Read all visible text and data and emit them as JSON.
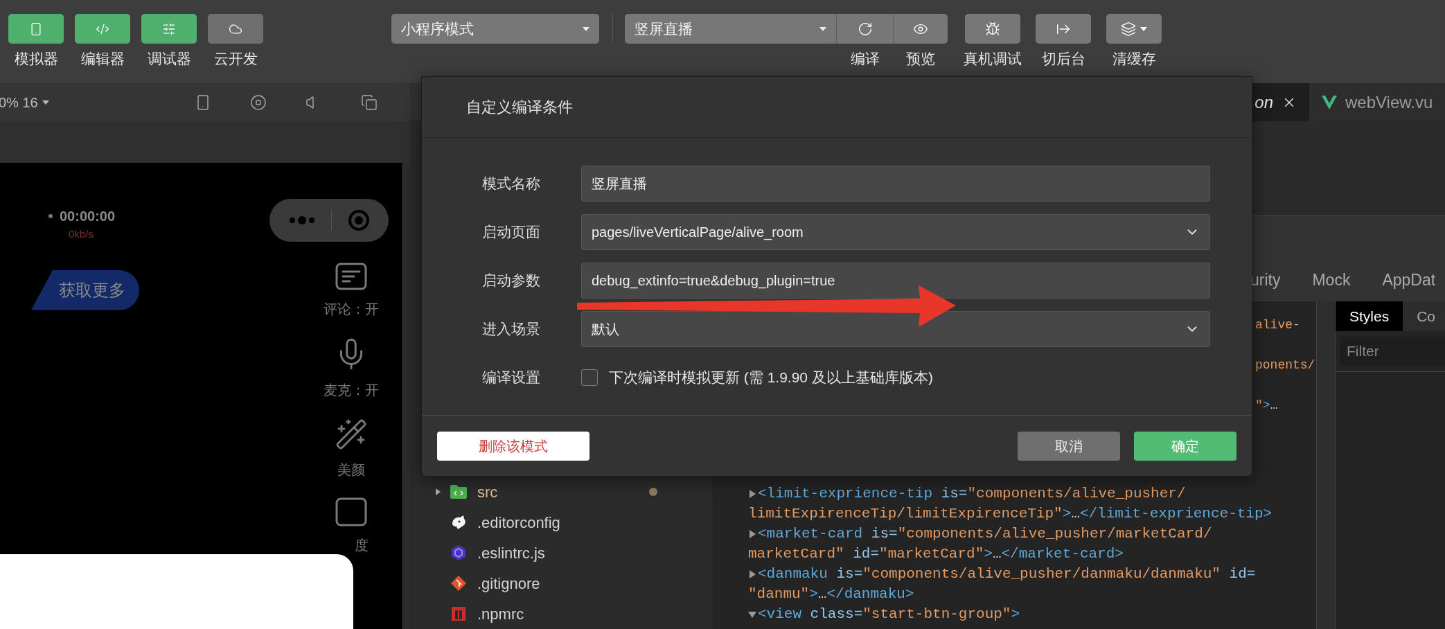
{
  "toolbar": {
    "views": [
      {
        "label": "模拟器",
        "on": true
      },
      {
        "label": "编辑器",
        "on": true
      },
      {
        "label": "调试器",
        "on": true
      },
      {
        "label": "云开发",
        "on": false
      }
    ],
    "mode_select": "小程序模式",
    "compile_select": "竖屏直播",
    "compile_actions": [
      {
        "label": "编译"
      },
      {
        "label": "预览"
      }
    ],
    "actions": [
      {
        "label": "真机调试"
      },
      {
        "label": "切后台"
      },
      {
        "label": "清缓存"
      }
    ]
  },
  "simulator": {
    "zoom": "0% 16",
    "timer": "00:00:00",
    "bitrate": "0kb/s",
    "more_badge": "获取更多",
    "side_controls": [
      {
        "label": "评论：开"
      },
      {
        "label": "麦克：开"
      },
      {
        "label": "美颜"
      },
      {
        "label": "度"
      }
    ]
  },
  "file_tree": [
    {
      "kind": "folder",
      "name": "src",
      "expanded": false,
      "modified": true
    },
    {
      "kind": "file",
      "name": ".editorconfig",
      "modified": false
    },
    {
      "kind": "file",
      "name": ".eslintrc.js",
      "modified": false
    },
    {
      "kind": "file",
      "name": ".gitignore",
      "modified": false
    },
    {
      "kind": "file",
      "name": ".npmrc",
      "modified": false
    }
  ],
  "editor_tabs": [
    {
      "label": "on",
      "selected": true
    },
    {
      "label": "webView.vu",
      "selected": false
    }
  ],
  "devtools": {
    "tabs": [
      {
        "label": "urity",
        "selected": false
      },
      {
        "label": "Mock",
        "selected": false
      },
      {
        "label": "AppDat",
        "selected": false
      }
    ],
    "code_fragments": [
      [
        {
          "kind": "val",
          "text": "alive-"
        }
      ],
      [
        {
          "kind": "val",
          "text": "ponents/"
        }
      ],
      [
        {
          "kind": "val",
          "text": "\""
        },
        {
          "kind": "tag",
          "text": ">"
        },
        {
          "kind": "text",
          "text": "…"
        }
      ]
    ],
    "code_lines": [
      {
        "kind": "node",
        "expanded": false,
        "tokens": [
          {
            "kind": "tag",
            "text": "<limit-exprience-tip"
          },
          {
            "kind": "attr",
            "text": " is="
          },
          {
            "kind": "val",
            "text": "\"components/alive_pusher/"
          }
        ]
      },
      {
        "kind": "wrap",
        "tokens": [
          {
            "kind": "val",
            "text": "limitExpirenceTip/limitExpirenceTip\""
          },
          {
            "kind": "tag",
            "text": ">"
          },
          {
            "kind": "text",
            "text": "…"
          },
          {
            "kind": "tag",
            "text": "</limit-exprience-tip>"
          }
        ]
      },
      {
        "kind": "node",
        "expanded": false,
        "tokens": [
          {
            "kind": "tag",
            "text": "<market-card"
          },
          {
            "kind": "attr",
            "text": " is="
          },
          {
            "kind": "val",
            "text": "\"components/alive_pusher/marketCard/"
          }
        ]
      },
      {
        "kind": "wrap",
        "tokens": [
          {
            "kind": "val",
            "text": "marketCard\""
          },
          {
            "kind": "attr",
            "text": " id="
          },
          {
            "kind": "val",
            "text": "\"marketCard\""
          },
          {
            "kind": "tag",
            "text": ">"
          },
          {
            "kind": "text",
            "text": "…"
          },
          {
            "kind": "tag",
            "text": "</market-card>"
          }
        ]
      },
      {
        "kind": "node",
        "expanded": false,
        "tokens": [
          {
            "kind": "tag",
            "text": "<danmaku"
          },
          {
            "kind": "attr",
            "text": " is="
          },
          {
            "kind": "val",
            "text": "\"components/alive_pusher/danmaku/danmaku\""
          },
          {
            "kind": "attr",
            "text": " id="
          }
        ]
      },
      {
        "kind": "wrap",
        "tokens": [
          {
            "kind": "val",
            "text": "\"danmu\""
          },
          {
            "kind": "tag",
            "text": ">"
          },
          {
            "kind": "text",
            "text": "…"
          },
          {
            "kind": "tag",
            "text": "</danmaku>"
          }
        ]
      },
      {
        "kind": "node",
        "expanded": true,
        "tokens": [
          {
            "kind": "tag",
            "text": "<view"
          },
          {
            "kind": "attr",
            "text": " class="
          },
          {
            "kind": "val",
            "text": "\"start-btn-group\""
          },
          {
            "kind": "tag",
            "text": ">"
          }
        ]
      }
    ],
    "styles_tabs": [
      {
        "label": "Styles",
        "selected": true
      },
      {
        "label": "Co",
        "selected": false
      }
    ],
    "filter_placeholder": "Filter"
  },
  "dialog": {
    "title": "自定义编译条件",
    "fields": [
      {
        "kind": "text",
        "label": "模式名称",
        "value": "竖屏直播"
      },
      {
        "kind": "select",
        "label": "启动页面",
        "value": "pages/liveVerticalPage/alive_room"
      },
      {
        "kind": "text",
        "label": "启动参数",
        "value": "debug_extinfo=true&debug_plugin=true"
      },
      {
        "kind": "select",
        "label": "进入场景",
        "value": "默认"
      },
      {
        "kind": "checkbox",
        "label": "编译设置",
        "text": "下次编译时模拟更新 (需 1.9.90 及以上基础库版本)",
        "checked": false
      }
    ],
    "delete_button": "删除该模式",
    "cancel_button": "取消",
    "confirm_button": "确定"
  }
}
